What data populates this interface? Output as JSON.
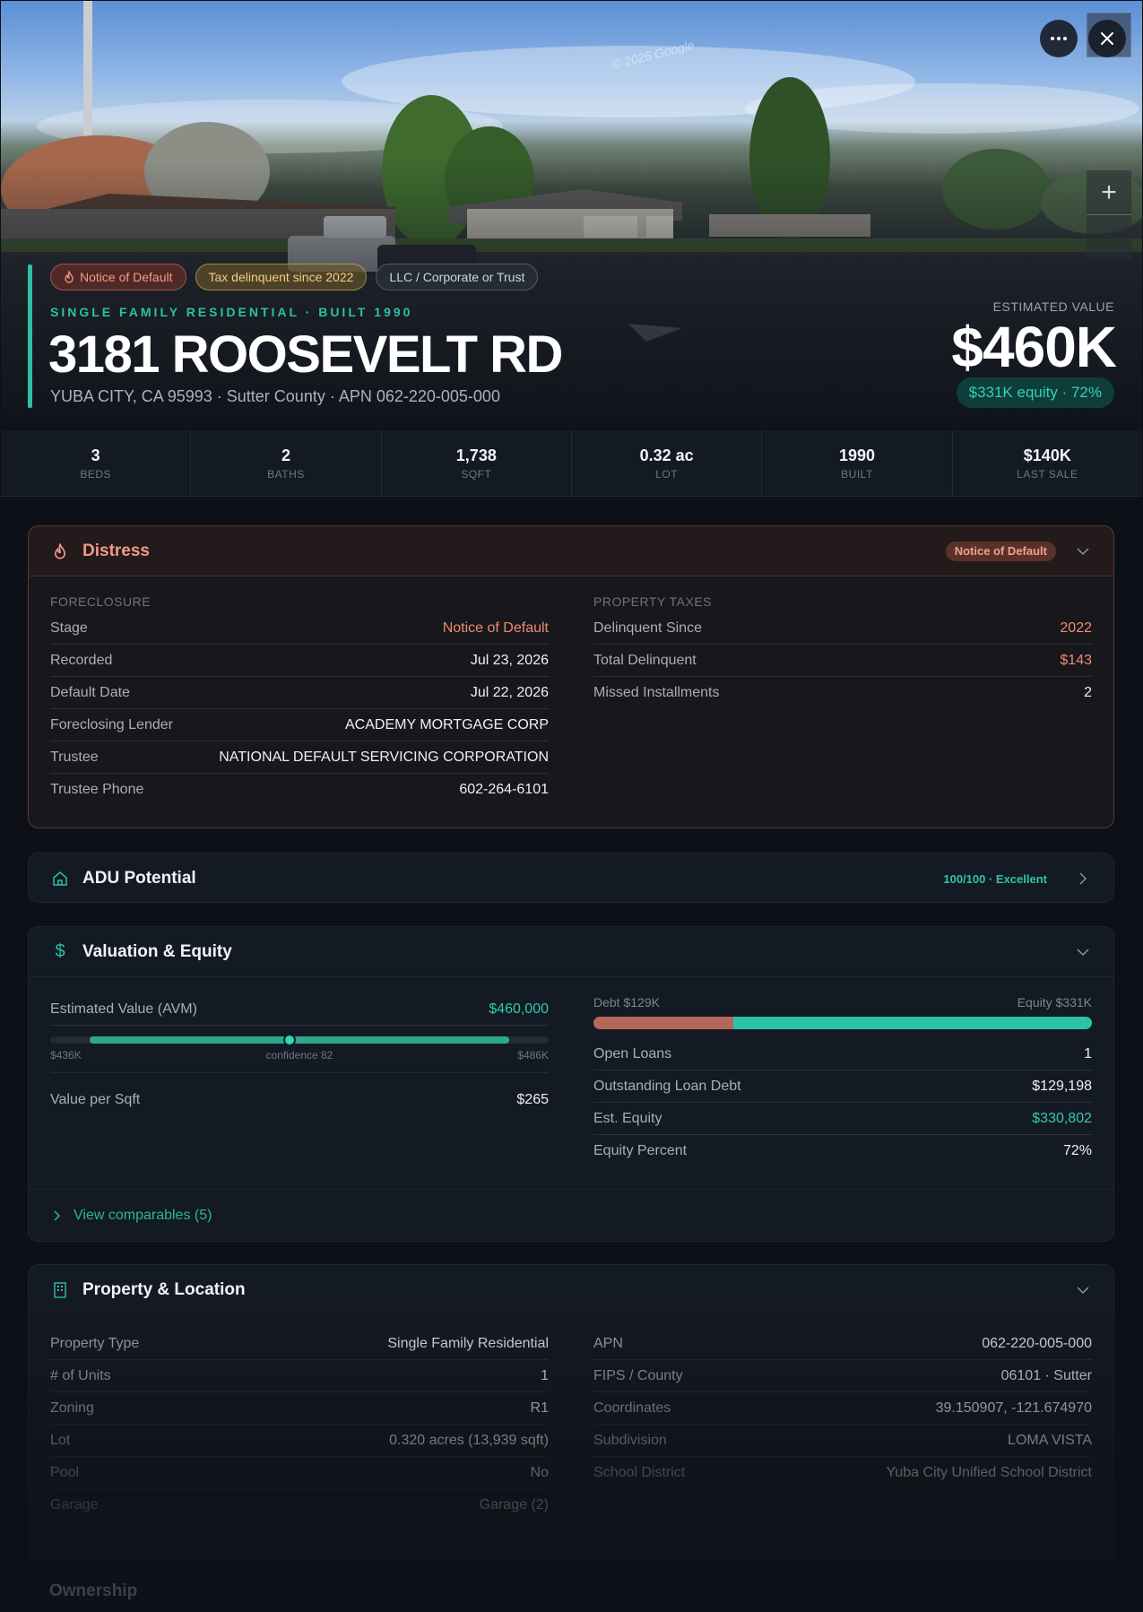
{
  "hero": {
    "watermark": "© 2026 Google",
    "badges": [
      {
        "label": "Notice of Default",
        "variant": "red",
        "icon": "flame-icon"
      },
      {
        "label": "Tax delinquent since 2022",
        "variant": "amber"
      },
      {
        "label": "LLC / Corporate or Trust",
        "variant": "grey"
      }
    ],
    "type_line": "SINGLE FAMILY RESIDENTIAL · BUILT 1990",
    "address": "3181 ROOSEVELT RD",
    "subline": "YUBA CITY, CA 95993 · Sutter County · APN 062-220-005-000",
    "estimated_value_label": "ESTIMATED VALUE",
    "estimated_value": "$460K",
    "equity_badge": "$331K equity · 72%"
  },
  "stats": [
    {
      "value": "3",
      "label": "BEDS"
    },
    {
      "value": "2",
      "label": "BATHS"
    },
    {
      "value": "1,738",
      "label": "SQFT"
    },
    {
      "value": "0.32 ac",
      "label": "LOT"
    },
    {
      "value": "1990",
      "label": "BUILT"
    },
    {
      "value": "$140K",
      "label": "LAST SALE"
    }
  ],
  "distress": {
    "title": "Distress",
    "pill": "Notice of Default",
    "foreclosure_label": "FORECLOSURE",
    "foreclosure": [
      {
        "k": "Stage",
        "v": "Notice of Default",
        "tone": "red"
      },
      {
        "k": "Recorded",
        "v": "Jul 23, 2026"
      },
      {
        "k": "Default Date",
        "v": "Jul 22, 2026"
      },
      {
        "k": "Foreclosing Lender",
        "v": "ACADEMY MORTGAGE CORP"
      },
      {
        "k": "Trustee",
        "v": "NATIONAL DEFAULT SERVICING CORPORATION"
      },
      {
        "k": "Trustee Phone",
        "v": "602-264-6101"
      }
    ],
    "taxes_label": "PROPERTY TAXES",
    "taxes": [
      {
        "k": "Delinquent Since",
        "v": "2022",
        "tone": "red"
      },
      {
        "k": "Total Delinquent",
        "v": "$143",
        "tone": "red"
      },
      {
        "k": "Missed Installments",
        "v": "2"
      }
    ]
  },
  "adu": {
    "title": "ADU Potential",
    "score": "100/100 · Excellent"
  },
  "valuation": {
    "title": "Valuation & Equity",
    "avm_label": "Estimated Value (AVM)",
    "avm_value": "$460,000",
    "avm_range": {
      "low": "$436K",
      "high": "$486K",
      "confidence": "confidence 82",
      "position_pct": 48
    },
    "value_per_sqft_label": "Value per Sqft",
    "value_per_sqft": "$265",
    "debt_label": "Debt $129K",
    "equity_label": "Equity $331K",
    "equity_percent": 72,
    "rows": [
      {
        "k": "Open Loans",
        "v": "1"
      },
      {
        "k": "Outstanding Loan Debt",
        "v": "$129,198"
      },
      {
        "k": "Est. Equity",
        "v": "$330,802",
        "tone": "teal"
      },
      {
        "k": "Equity Percent",
        "v": "72%"
      }
    ],
    "comparables": "View comparables (5)"
  },
  "property": {
    "title": "Property & Location",
    "left": [
      {
        "k": "Property Type",
        "v": "Single Family Residential"
      },
      {
        "k": "# of Units",
        "v": "1"
      },
      {
        "k": "Zoning",
        "v": "R1"
      },
      {
        "k": "Lot",
        "v": "0.320 acres (13,939 sqft)"
      },
      {
        "k": "Pool",
        "v": "No"
      },
      {
        "k": "Garage",
        "v": "Garage (2)"
      }
    ],
    "right": [
      {
        "k": "APN",
        "v": "062-220-005-000"
      },
      {
        "k": "FIPS / County",
        "v": "06101 · Sutter"
      },
      {
        "k": "Coordinates",
        "v": "39.150907, -121.674970"
      },
      {
        "k": "Subdivision",
        "v": "LOMA VISTA"
      },
      {
        "k": "School District",
        "v": "Yuba City Unified School District"
      }
    ]
  },
  "ownership": {
    "title": "Ownership"
  },
  "colors": {
    "accent": "#2dbfa7",
    "distress": "#f29884",
    "debt": "#b5675a"
  }
}
